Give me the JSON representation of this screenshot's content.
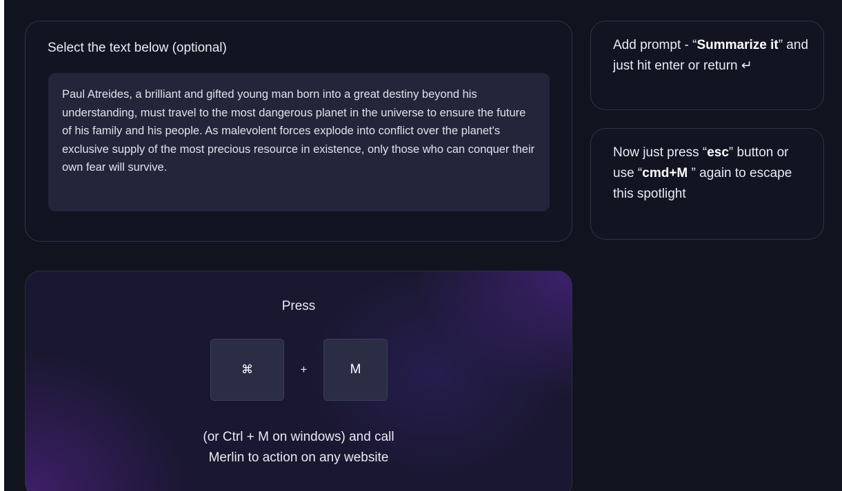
{
  "select_card": {
    "heading": "Select the text below (optional)",
    "sample_text": "Paul Atreides, a brilliant and gifted young man born into a great destiny beyond his understanding, must travel to the most dangerous planet in the universe to ensure the future of his family and his people. As malevolent forces explode into conflict over the planet's exclusive supply of the most precious resource in existence, only those who can conquer their own fear will survive."
  },
  "prompt_card": {
    "prefix": "Add prompt - “",
    "prompt": "Summarize it",
    "suffix": "” and just hit enter or return ",
    "return_glyph": "↵"
  },
  "esc_card": {
    "prefix": "Now just press “",
    "esc_key": "esc",
    "middle": "” button or use “",
    "shortcut": "cmd+M",
    "suffix": " ” again to escape this spotlight"
  },
  "press_card": {
    "label": "Press",
    "key1": "⌘",
    "plus": "+",
    "key2": "M",
    "footer_line1": "(or Ctrl + M on windows) and call",
    "footer_line2": "Merlin to action on any website"
  },
  "colors": {
    "background": "#11131f",
    "card_border": "#2f3345",
    "text_box": "#23263a",
    "key_fill": "#2b2d45",
    "accent_purple": "#5c2696"
  }
}
